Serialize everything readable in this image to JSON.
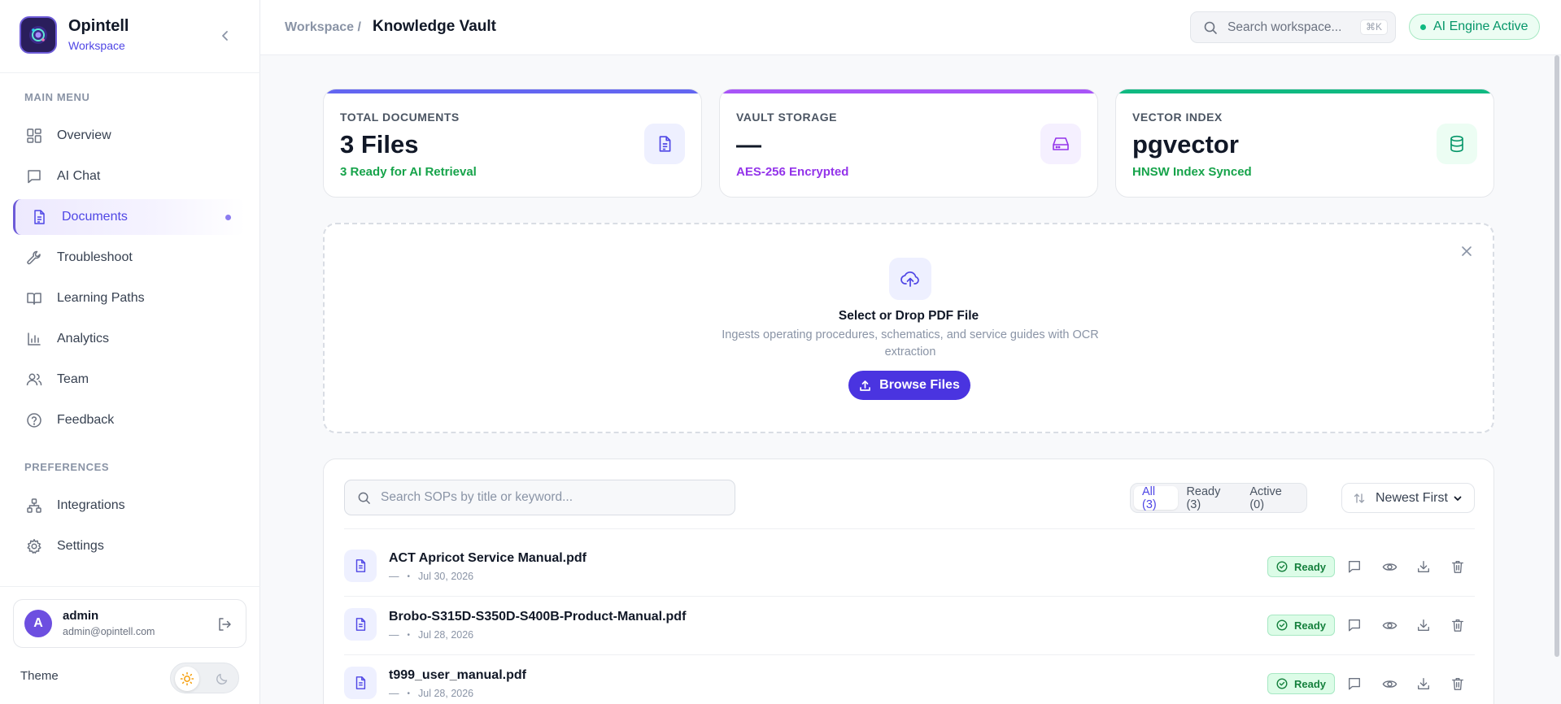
{
  "brand": {
    "name": "Opintell",
    "subtitle": "Workspace"
  },
  "sidebar": {
    "main_menu_label": "MAIN MENU",
    "preferences_label": "PREFERENCES",
    "main_items": [
      {
        "label": "Overview",
        "icon": "grid-icon"
      },
      {
        "label": "AI Chat",
        "icon": "chat-icon"
      },
      {
        "label": "Documents",
        "icon": "document-icon",
        "active": true
      },
      {
        "label": "Troubleshoot",
        "icon": "wrench-icon"
      },
      {
        "label": "Learning Paths",
        "icon": "book-icon"
      },
      {
        "label": "Analytics",
        "icon": "bar-chart-icon"
      },
      {
        "label": "Team",
        "icon": "users-icon"
      },
      {
        "label": "Feedback",
        "icon": "help-circle-icon"
      }
    ],
    "pref_items": [
      {
        "label": "Integrations",
        "icon": "network-icon"
      },
      {
        "label": "Settings",
        "icon": "gear-icon"
      }
    ],
    "user": {
      "initial": "A",
      "name": "admin",
      "email": "admin@opintell.com"
    },
    "theme_label": "Theme"
  },
  "header": {
    "breadcrumb_parent": "Workspace /",
    "breadcrumb_current": "Knowledge Vault",
    "search_placeholder": "Search workspace...",
    "search_shortcut": "⌘K",
    "engine_status": "AI Engine Active"
  },
  "stats": [
    {
      "label": "TOTAL DOCUMENTS",
      "value": "3 Files",
      "sub": "3 Ready for AI Retrieval",
      "accent": "#6366f1",
      "sub_color": "#16a34a",
      "icon": "document-icon"
    },
    {
      "label": "VAULT STORAGE",
      "value": "—",
      "sub": "AES-256 Encrypted",
      "accent": "#a855f7",
      "sub_color": "#9333ea",
      "icon": "hard-drive-icon"
    },
    {
      "label": "VECTOR INDEX",
      "value": "pgvector",
      "sub": "HNSW Index Synced",
      "accent": "#10b981",
      "sub_color": "#16a34a",
      "icon": "database-icon"
    }
  ],
  "upload": {
    "title": "Select or Drop PDF File",
    "description": "Ingests operating procedures, schematics, and service guides with OCR extraction",
    "button_label": "Browse Files"
  },
  "documents": {
    "search_placeholder": "Search SOPs by title or keyword...",
    "filters": [
      {
        "label": "All (3)",
        "active": true
      },
      {
        "label": "Ready (3)",
        "active": false
      },
      {
        "label": "Active (0)",
        "active": false
      }
    ],
    "sort_label": "Newest First",
    "rows": [
      {
        "title": "ACT Apricot Service Manual.pdf",
        "size": "—",
        "date": "Jul 30, 2026",
        "status": "Ready"
      },
      {
        "title": "Brobo-S315D-S350D-S400B-Product-Manual.pdf",
        "size": "—",
        "date": "Jul 28, 2026",
        "status": "Ready"
      },
      {
        "title": "t999_user_manual.pdf",
        "size": "—",
        "date": "Jul 28, 2026",
        "status": "Ready"
      }
    ]
  }
}
